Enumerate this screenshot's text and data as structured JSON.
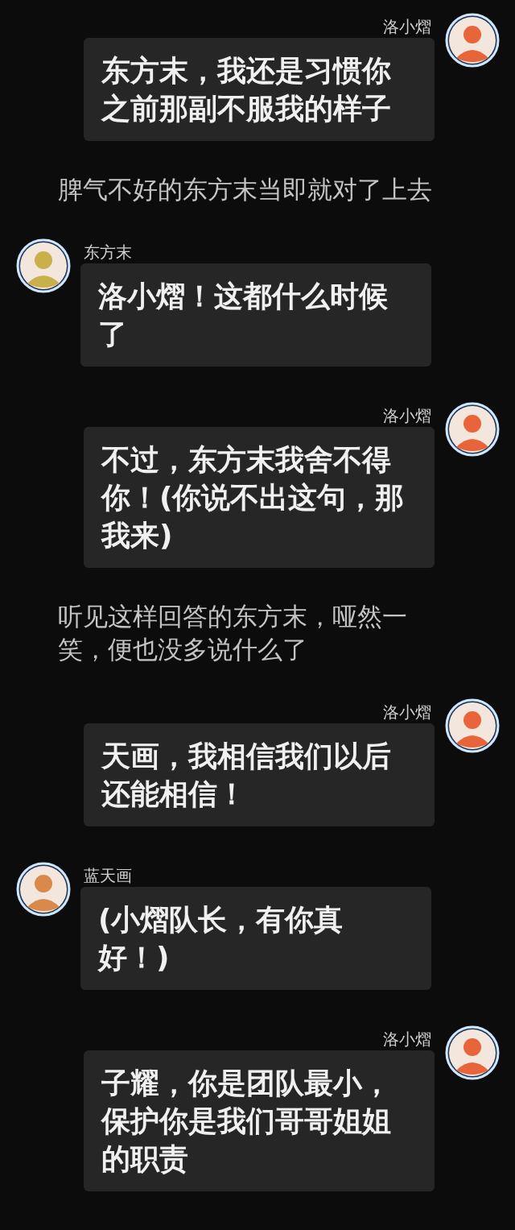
{
  "items": [
    {
      "kind": "sent",
      "name": "洛小熠",
      "color": "#e8643a",
      "lines": [
        "东方末，我还是习惯你",
        "之前那副不服我的样子"
      ]
    },
    {
      "kind": "narration",
      "lines": [
        "脾气不好的东方末当即就对了上去"
      ]
    },
    {
      "kind": "received",
      "name": "东方末",
      "color": "#c9b04a",
      "lines": [
        "洛小熠！这都什么时候",
        "了"
      ]
    },
    {
      "kind": "sent",
      "name": "洛小熠",
      "color": "#e8643a",
      "lines": [
        "不过，东方末我舍不得",
        "你！(你说不出这句，那",
        "我来)"
      ]
    },
    {
      "kind": "narration",
      "lines": [
        "听见这样回答的东方末，哑然一",
        "笑，便也没多说什么了"
      ]
    },
    {
      "kind": "sent",
      "name": "洛小熠",
      "color": "#e8643a",
      "lines": [
        "天画，我相信我们以后",
        "还能相信！"
      ]
    },
    {
      "kind": "received",
      "name": "蓝天画",
      "color": "#d98a4a",
      "lines": [
        "(小熠队长，有你真",
        "好！)"
      ]
    },
    {
      "kind": "sent",
      "name": "洛小熠",
      "color": "#e8643a",
      "lines": [
        "子耀，你是团队最小，",
        "保护你是我们哥哥姐姐",
        "的职责"
      ]
    }
  ]
}
